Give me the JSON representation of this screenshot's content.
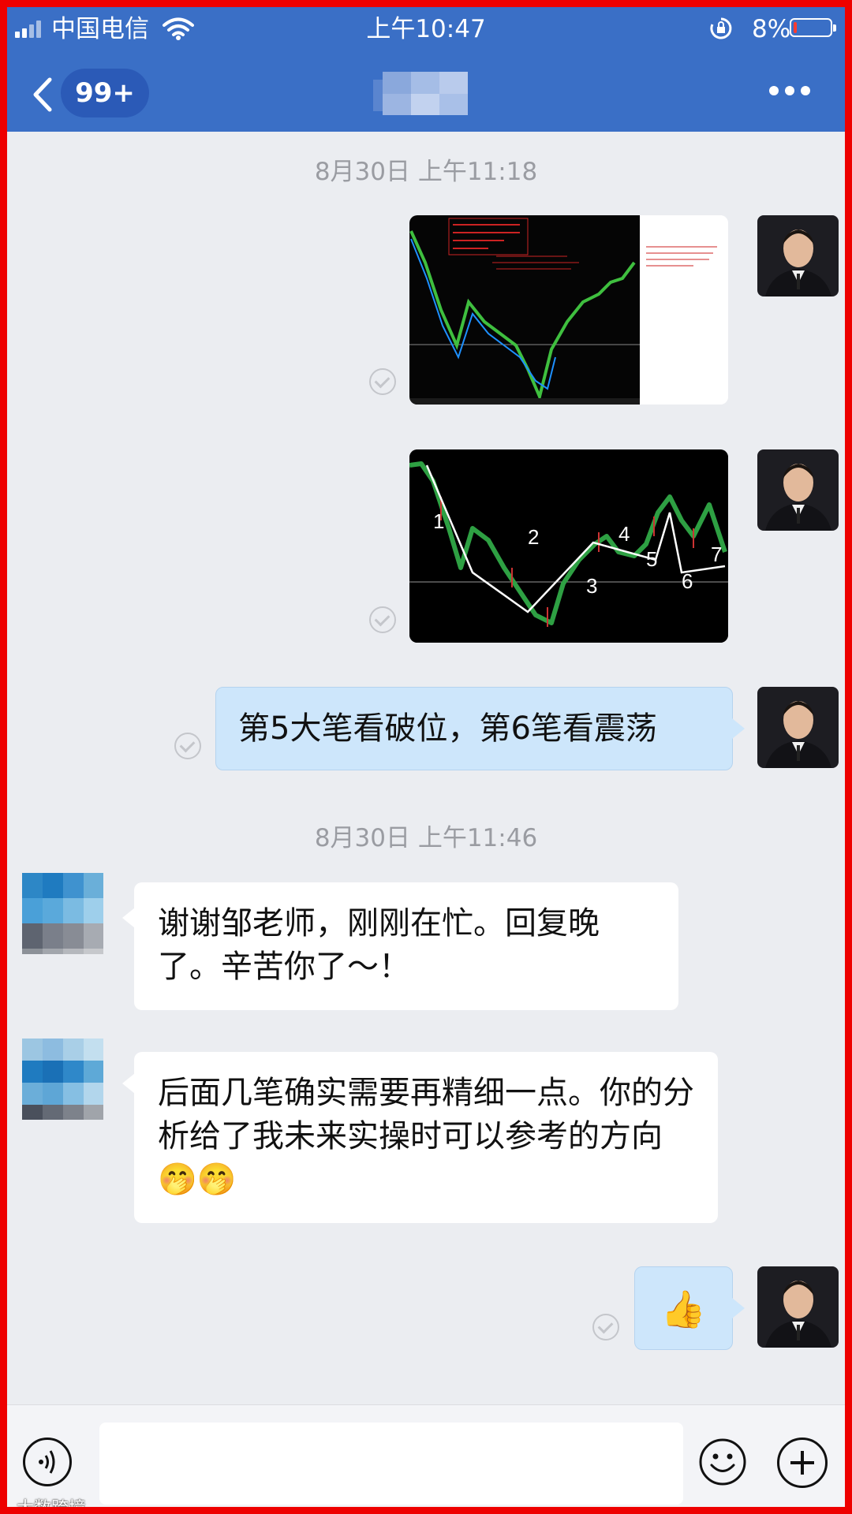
{
  "status_bar": {
    "carrier": "中国电信",
    "time": "上午10:47",
    "battery": "8%",
    "battery_level": 0.08
  },
  "header": {
    "back_icon": "chevron-left-icon",
    "unread_badge": "99+",
    "more_icon": "ellipsis-icon"
  },
  "chat": {
    "timestamps": [
      "8月30日 上午11:18",
      "8月30日 上午11:46"
    ],
    "messages": [
      {
        "from": "me",
        "type": "image",
        "content": "K-line chart screenshot with red annotations"
      },
      {
        "from": "me",
        "type": "image",
        "content": "K-line chart with hand-drawn strokes",
        "labels": [
          "1",
          "2",
          "3",
          "4",
          "5",
          "6",
          "7"
        ]
      },
      {
        "from": "me",
        "type": "text",
        "text": "第5大笔看破位，第6笔看震荡"
      },
      {
        "from": "them",
        "type": "text",
        "text": "谢谢邹老师，刚刚在忙。回复晚了。辛苦你了～！"
      },
      {
        "from": "them",
        "type": "text",
        "text": "后面几笔确实需要再精细一点。你的分析给了我未来实操时可以参考的方向🤭🤭"
      },
      {
        "from": "me",
        "type": "emoji",
        "text": "👍"
      }
    ]
  },
  "input_bar": {
    "voice_icon": "voice-icon",
    "emoji_icon": "smiley-icon",
    "plus_icon": "plus-icon",
    "placeholder": ""
  },
  "watermark": "大数跨境",
  "colors": {
    "header": "#3a6fc6",
    "frame_border": "#ee0000",
    "outgoing_bubble": "#cde6fb",
    "chat_background": "#ebedf1"
  }
}
